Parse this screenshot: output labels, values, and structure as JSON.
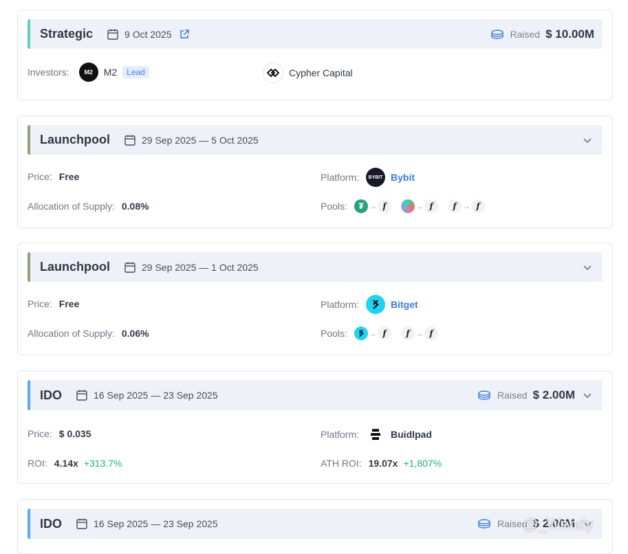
{
  "colors": {
    "strategic_accent": "#5fd1b4",
    "launchpool_accent": "#8fa07a",
    "ido_accent": "#5aa9f0",
    "link": "#3d7be0",
    "positive": "#20b27a"
  },
  "cards": [
    {
      "type": "Strategic",
      "date": "9 Oct 2025",
      "raised_label": "Raised",
      "raised": "$ 10.00M",
      "investors_label": "Investors:",
      "investor1": "M2",
      "investor1_logo": "M2",
      "lead": "Lead",
      "investor2": "Cypher Capital"
    },
    {
      "type": "Launchpool",
      "date": "29 Sep 2025 — 5 Oct 2025",
      "price_label": "Price:",
      "price": "Free",
      "platform_label": "Platform:",
      "platform": "Bybit",
      "platform_logo": "BYBIT",
      "alloc_label": "Allocation of Supply:",
      "alloc": "0.08%",
      "pools_label": "Pools:"
    },
    {
      "type": "Launchpool",
      "date": "29 Sep 2025 — 1 Oct 2025",
      "price_label": "Price:",
      "price": "Free",
      "platform_label": "Platform:",
      "platform": "Bitget",
      "alloc_label": "Allocation of Supply:",
      "alloc": "0.06%",
      "pools_label": "Pools:"
    },
    {
      "type": "IDO",
      "date": "16 Sep 2025 — 23 Sep 2025",
      "raised_label": "Raised",
      "raised": "$ 2.00M",
      "price_label": "Price:",
      "price": "$ 0.035",
      "platform_label": "Platform:",
      "platform": "Buidlpad",
      "roi_label": "ROI:",
      "roi": "4.14x",
      "roi_pct": "+313.7%",
      "ath_label": "ATH ROI:",
      "ath": "19.07x",
      "ath_pct": "+1,807%"
    },
    {
      "type": "IDO",
      "date": "16 Sep 2025 — 23 Sep 2025",
      "raised_label": "Raised",
      "raised": "$ 2.00M"
    }
  ],
  "pool_token": "f",
  "watermark": "@_Wendy"
}
